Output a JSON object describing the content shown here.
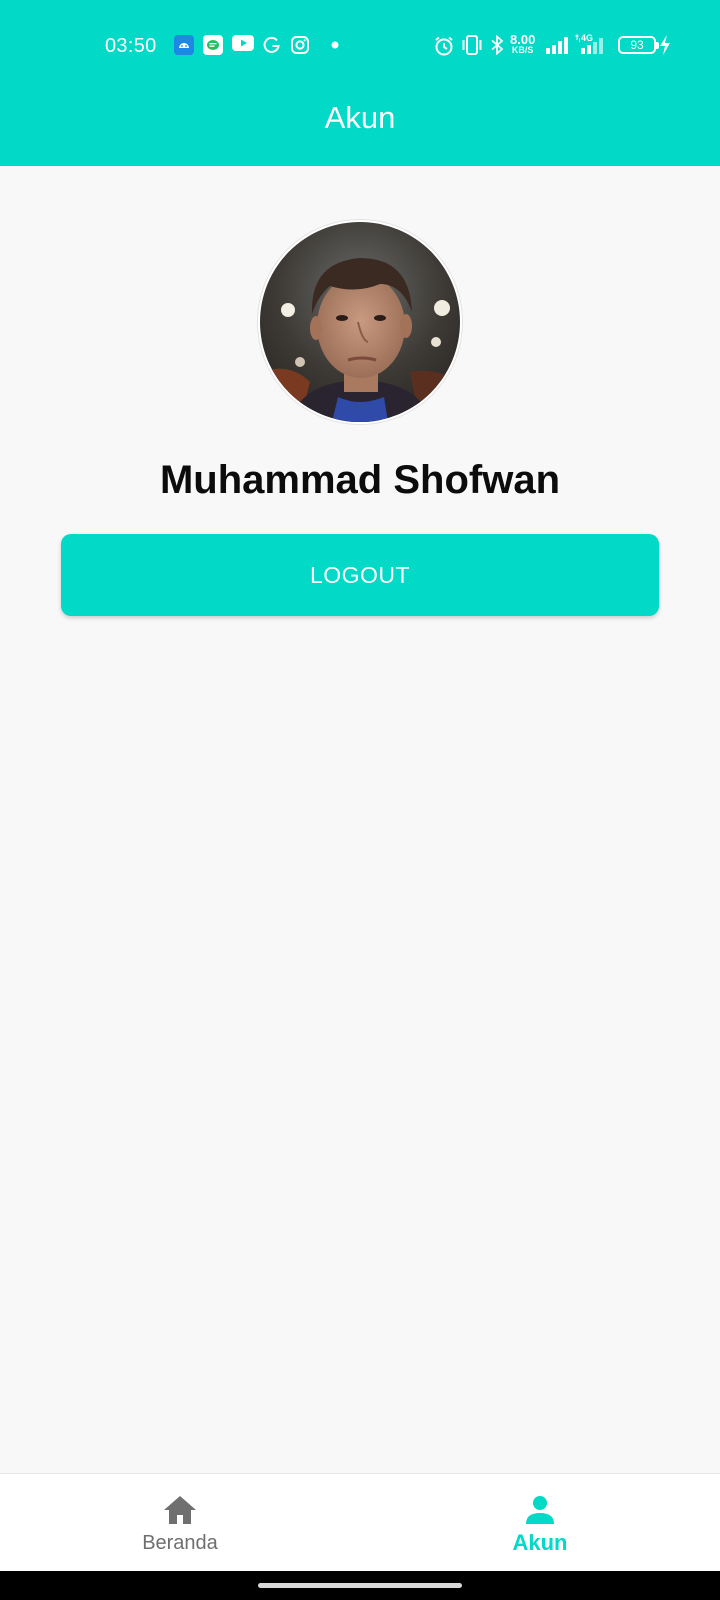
{
  "status_bar": {
    "time": "03:50",
    "net_speed_value": "8.00",
    "net_speed_unit": "KB/S",
    "network_type": "4G",
    "battery_level": "93",
    "left_icons": [
      "android-icon",
      "chat-icon",
      "youtube-icon",
      "g-icon",
      "instagram-icon",
      "dot-icon"
    ],
    "right_icons": [
      "alarm-icon",
      "vibrate-icon",
      "bluetooth-icon",
      "signal-icon",
      "signal-4g-icon",
      "battery-icon",
      "charging-icon"
    ]
  },
  "app_bar": {
    "title": "Akun"
  },
  "profile": {
    "name": "Muhammad Shofwan",
    "avatar_icon": "profile-photo"
  },
  "actions": {
    "logout_label": "LOGOUT"
  },
  "bottom_nav": {
    "items": [
      {
        "label": "Beranda",
        "icon": "home-icon",
        "active": false
      },
      {
        "label": "Akun",
        "icon": "person-icon",
        "active": true
      }
    ]
  },
  "colors": {
    "primary": "#02d9c7",
    "background": "#f8f8f9",
    "inactive": "#6f6f6f",
    "text": "#0c0c0c"
  }
}
